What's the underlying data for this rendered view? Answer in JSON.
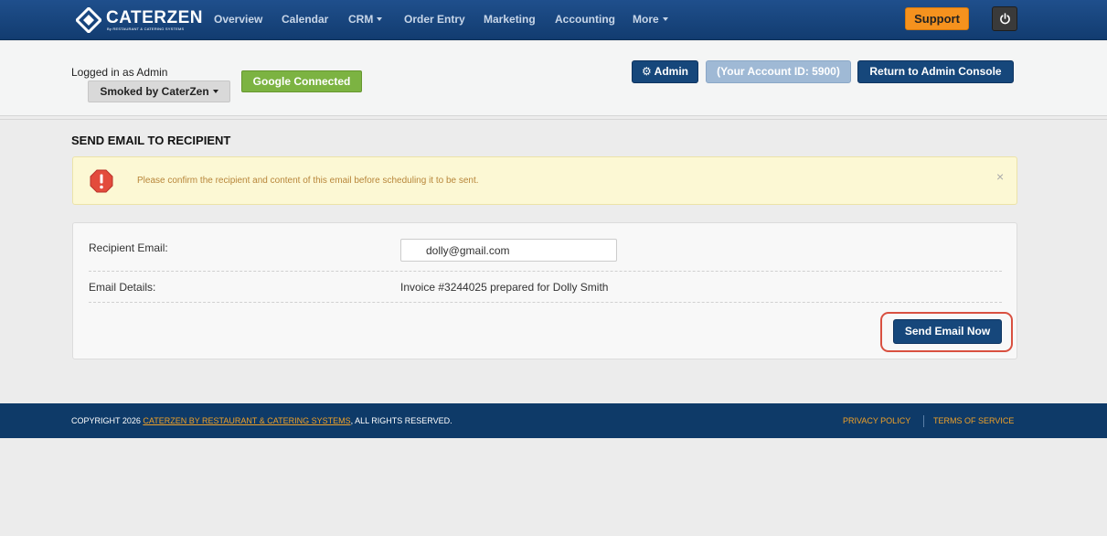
{
  "brand": {
    "name": "CATERZEN",
    "tagline": "By RESTAURANT & CATERING SYSTEMS"
  },
  "nav": {
    "items": [
      {
        "label": "Overview"
      },
      {
        "label": "Calendar"
      },
      {
        "label": "CRM",
        "dropdown": true
      },
      {
        "label": "Order Entry"
      },
      {
        "label": "Marketing"
      },
      {
        "label": "Accounting"
      },
      {
        "label": "More",
        "dropdown": true
      }
    ],
    "support_label": "Support",
    "power_icon": "power-icon"
  },
  "header": {
    "logged_in_text": "Logged in as Admin",
    "account_selector": "Smoked by CaterZen",
    "google_status": "Google Connected",
    "admin_label": "Admin",
    "account_id_label": "(Your Account ID: 5900)",
    "return_label": "Return to Admin Console"
  },
  "page": {
    "title": "SEND EMAIL TO RECIPIENT",
    "alert": {
      "message": "Please confirm the recipient and content of this email before scheduling it to be sent.",
      "close": "×"
    },
    "form": {
      "recipient_label": "Recipient Email:",
      "recipient_value": "dolly@gmail.com",
      "details_label": "Email Details:",
      "details_value": "Invoice #3244025 prepared for Dolly Smith",
      "send_label": "Send Email Now"
    }
  },
  "footer": {
    "copyright_prefix": "COPYRIGHT 2026 ",
    "copyright_link": "CATERZEN BY RESTAURANT & CATERING SYSTEMS",
    "copyright_suffix": ", ALL RIGHTS RESERVED.",
    "privacy": "PRIVACY POLICY",
    "terms": "TERMS OF SERVICE"
  },
  "colors": {
    "nav_bg": "#1a4a83",
    "primary_button": "#16477b",
    "support": "#f5921e",
    "google": "#7cb342",
    "alert_bg": "#fcf8d4",
    "highlight": "#d95040",
    "footer_link": "#f0a128"
  }
}
